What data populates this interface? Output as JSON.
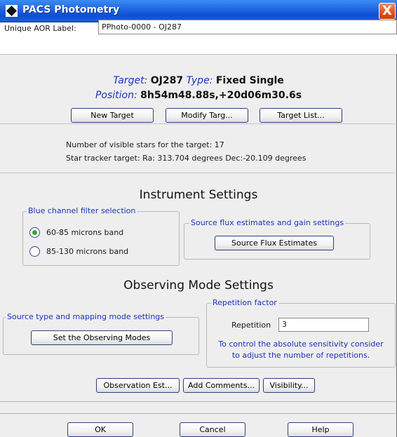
{
  "window": {
    "title": "PACS Photometry",
    "close_glyph": "X",
    "icon": "diamond-icon"
  },
  "aor": {
    "label": "Unique AOR Label:",
    "value": "PPhoto-0000 - OJ287"
  },
  "target": {
    "target_key": "Target:",
    "target_value": "OJ287",
    "type_key": "Type:",
    "type_value": "Fixed Single",
    "position_key": "Position:",
    "position_value": "8h54m48.88s,+20d06m30.6s",
    "buttons": {
      "new": "New Target",
      "modify": "Modify Targ...",
      "list": "Target List..."
    }
  },
  "stars": {
    "visible": "Number of visible stars for the target: 17",
    "tracker": "Star tracker target: Ra: 313.704 degrees Dec:-20.109 degrees"
  },
  "instrument": {
    "title": "Instrument Settings",
    "filter_group_label": "Blue channel filter selection",
    "option_1": "60-85 microns band",
    "option_2": "85-130 microns band",
    "selected_option": "60-85 microns band",
    "flux_group_label": "Source flux estimates and gain settings",
    "flux_button": "Source Flux Estimates"
  },
  "observing": {
    "title": "Observing Mode Settings",
    "mode_group_label": "Source type and mapping mode settings",
    "mode_button": "Set the Observing Modes",
    "rep_group_label": "Repetition factor",
    "rep_label": "Repetition",
    "rep_value": "3",
    "rep_help_1": "To control the absolute sensitivity consider",
    "rep_help_2": "to adjust the number of repetitions."
  },
  "actions": {
    "obs_est": "Observation Est...",
    "comments": "Add Comments...",
    "visibility": "Visibility..."
  },
  "footer": {
    "ok": "OK",
    "cancel": "Cancel",
    "help": "Help"
  },
  "colors": {
    "titlebar": "#1f63e0",
    "label_blue": "#1c34b7",
    "close_red": "#e0501d",
    "radio_green": "#2faa2f"
  }
}
